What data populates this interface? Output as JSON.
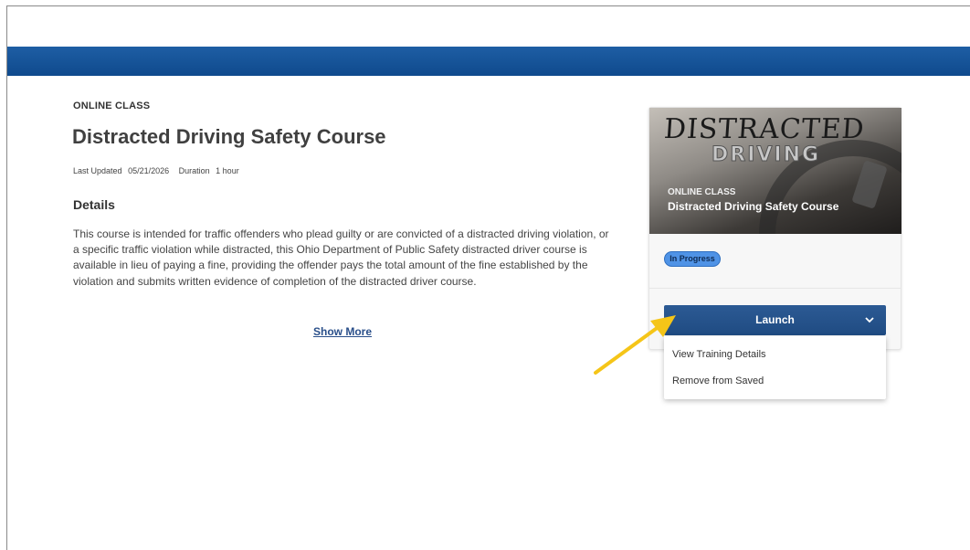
{
  "header": {
    "bar_color": "#1a5799"
  },
  "course": {
    "type_label": "ONLINE CLASS",
    "title": "Distracted Driving Safety Course",
    "last_updated_label": "Last Updated",
    "last_updated_value": "05/21/2026",
    "duration_label": "Duration",
    "duration_value": "1 hour",
    "details_heading": "Details",
    "description": "This course is intended for traffic offenders who plead guilty or are convicted of a distracted driving violation, or a specific traffic violation while distracted, this Ohio Department of Public Safety distracted driver course is available in lieu of paying a fine, providing the offender pays the total amount of the fine established by the violation and submits written evidence of completion of the distracted driver course.",
    "show_more_label": "Show More"
  },
  "card": {
    "image_word1": "DISTRACTED",
    "image_word2": "DRIVING",
    "type_label": "ONLINE CLASS",
    "title": "Distracted Driving Safety Course",
    "status_badge": "In Progress",
    "launch_label": "Launch",
    "menu_items": [
      "View Training Details",
      "Remove from Saved"
    ]
  },
  "annotation": {
    "arrow_color": "#f5c518"
  }
}
